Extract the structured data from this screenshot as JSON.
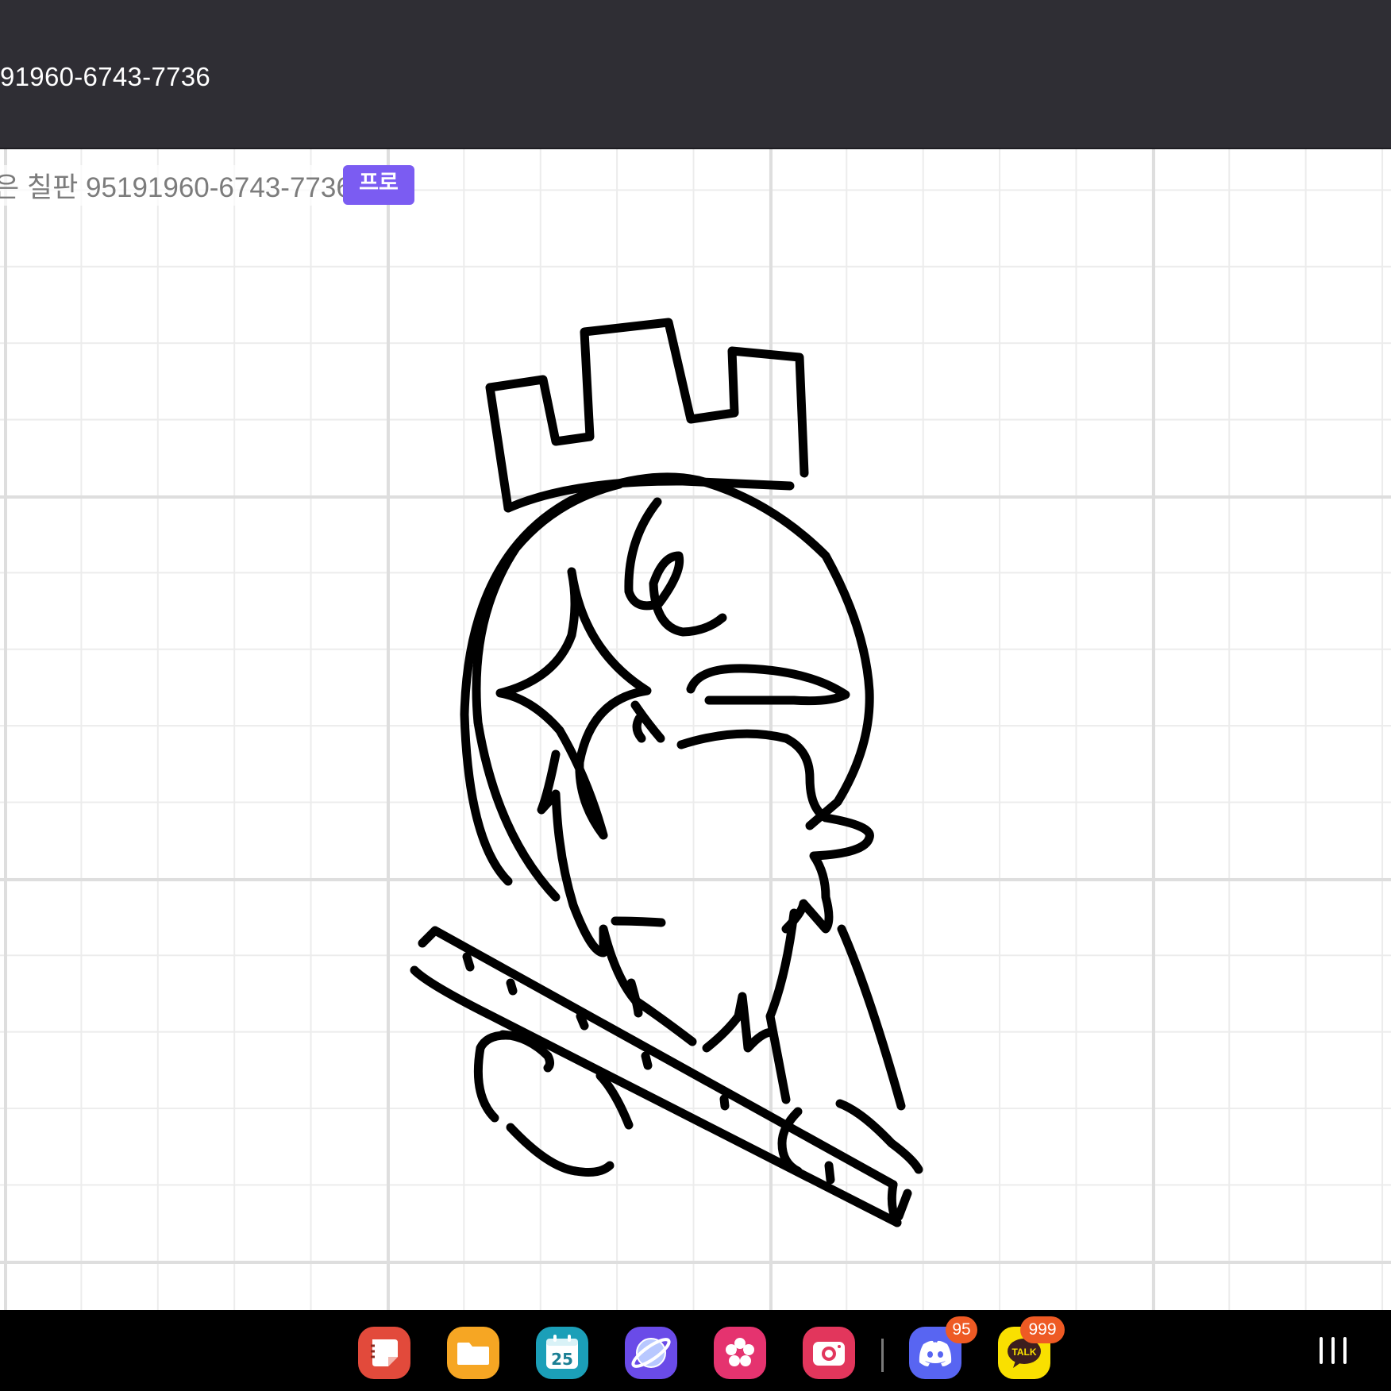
{
  "window": {
    "title": "91960-6743-7736"
  },
  "board": {
    "title": "은 칠판 95191960-6743-7736",
    "badge": "프로"
  },
  "taskbar": {
    "apps": [
      {
        "name": "Notes",
        "icon": "notes-icon",
        "color": "#e24a3b"
      },
      {
        "name": "My Files",
        "icon": "folder-icon",
        "color": "#f6a623"
      },
      {
        "name": "Calendar",
        "icon": "calendar-icon",
        "color": "#1b9fb8",
        "label": "25"
      },
      {
        "name": "Internet",
        "icon": "browser-icon",
        "color": "#6a4be8"
      },
      {
        "name": "Gallery",
        "icon": "gallery-icon",
        "color": "#e5336f"
      },
      {
        "name": "Camera",
        "icon": "camera-icon",
        "color": "#e2365c"
      },
      {
        "name": "Discord",
        "icon": "discord-icon",
        "color": "#5865f2",
        "badge": "95"
      },
      {
        "name": "KakaoTalk",
        "icon": "kakaotalk-icon",
        "color": "#f9e000",
        "label": "TALK",
        "badge": "999"
      }
    ],
    "recents_icon": "recents-icon"
  }
}
